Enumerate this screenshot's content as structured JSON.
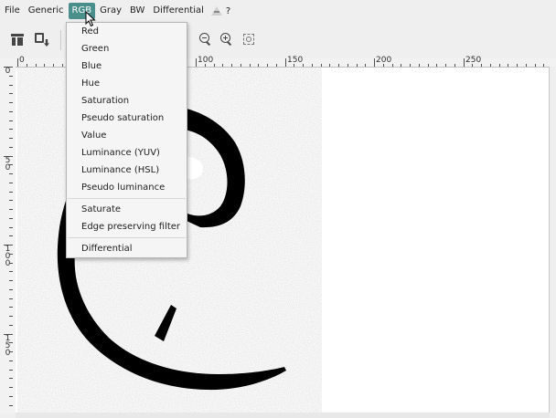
{
  "menubar": {
    "items": [
      "File",
      "Generic",
      "RGB",
      "Gray",
      "BW",
      "Differential"
    ],
    "help_label": "?",
    "about_icon": "about-icon",
    "active_index": 2,
    "active_color": "#4a8f8c"
  },
  "toolbar": {
    "icons": [
      "open-icon",
      "export-icon",
      "zoom-out-icon",
      "zoom-in-icon",
      "zoom-fit-icon"
    ]
  },
  "rgb_menu": {
    "group1": [
      "Red",
      "Green",
      "Blue",
      "Hue",
      "Saturation",
      "Pseudo saturation",
      "Value",
      "Luminance (YUV)",
      "Luminance (HSL)",
      "Pseudo luminance"
    ],
    "group2": [
      "Saturate",
      "Edge preserving filter"
    ],
    "group3": [
      "Differential"
    ]
  },
  "rulers": {
    "top_labels": [
      "0",
      "100",
      "150",
      "200",
      "250"
    ],
    "left_labels": [
      "0",
      "5\n0",
      "1\n0\n0",
      "1\n5\n0"
    ]
  }
}
